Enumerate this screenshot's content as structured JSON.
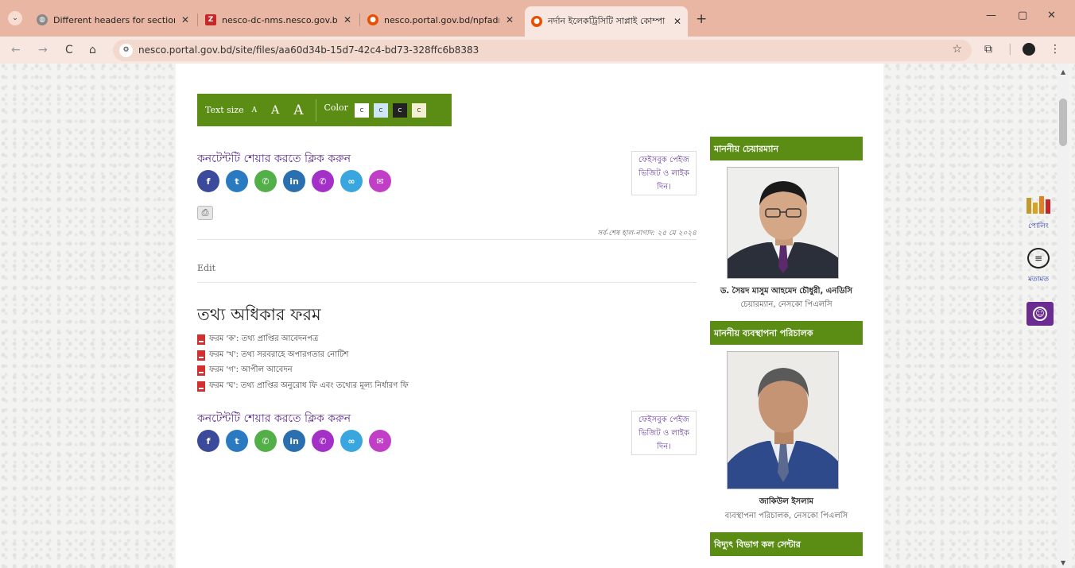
{
  "browser": {
    "tabs": [
      {
        "title": "Different headers for sections",
        "active": false
      },
      {
        "title": "nesco-dc-nms.nesco.gov.bd: H",
        "active": false
      },
      {
        "title": "nesco.portal.gov.bd/npfadmin/",
        "active": false
      },
      {
        "title": "নর্দান ইলেকট্রিসিটি সাপ্লাই কোম্পা",
        "active": true
      }
    ],
    "url": "nesco.portal.gov.bd/site/files/aa60d34b-15d7-42c4-bd73-328ffc6b8383",
    "accent_color": "#e9b6a4"
  },
  "accessibility_bar": {
    "text_size_label": "Text size",
    "size_small": "A",
    "size_medium": "A",
    "size_large": "A",
    "color_label": "Color",
    "swatches": [
      "C",
      "C",
      "C",
      "C"
    ]
  },
  "share": {
    "title": "কনটেন্টটি শেয়ার করতে ক্লিক করুন",
    "facebook_visit": "ফেইসবুক পেইজ ভিজিট ও লাইক দিন।",
    "icons": [
      {
        "name": "facebook-icon",
        "glyph": "f",
        "color": "#3b4a9a"
      },
      {
        "name": "twitter-icon",
        "glyph": "🐦",
        "color": "#2a7ac2"
      },
      {
        "name": "whatsapp-icon",
        "glyph": "✆",
        "color": "#53b048"
      },
      {
        "name": "linkedin-icon",
        "glyph": "in",
        "color": "#2a6fb0"
      },
      {
        "name": "viber-icon",
        "glyph": "✆",
        "color": "#a331c8"
      },
      {
        "name": "link-icon",
        "glyph": "🔗",
        "color": "#3aa6e0"
      },
      {
        "name": "messenger-icon",
        "glyph": "✉",
        "color": "#c03fc6"
      }
    ]
  },
  "page": {
    "last_updated": "সর্ব-শেষ হাল-নাগাদ: ২৫ মে ২০২৪",
    "edit_label": "Edit",
    "title": "তথ্য অধিকার ফরম",
    "forms": [
      "ফরম 'ক': তথ্য প্রাপ্তির আবেদনপত্র",
      "ফরম 'খ': তথ্য সরবরাহে অপারগতার নোটিশ",
      "ফরম 'গ': আপীল আবেদন",
      "ফরম 'ঘ': তথ্য প্রাপ্তির অনুরোধ ফি এবং তথ্যের মূল্য নির্ধারণ ফি"
    ]
  },
  "sidebar": {
    "chairman_heading": "মাননীয় চেয়ারম্যান",
    "chairman_name": "ড. সৈয়দ মাসুম আহমেদ চৌধুরী, এনডিসি",
    "chairman_title": "চেয়ারম্যান, নেসকো পিএলসি",
    "md_heading": "মাননীয় ব্যবস্থাপনা পরিচালক",
    "md_name": "জাকিউল ইসলাম",
    "md_title": "ব্যবস্থাপনা পরিচালক, নেসকো পিএলসি",
    "call_center_heading": "বিদ্যুৎ বিভাগ কল সেন্টার"
  },
  "widgets": {
    "poll_label": "পোলিং",
    "feedback_label": "মতামত"
  }
}
